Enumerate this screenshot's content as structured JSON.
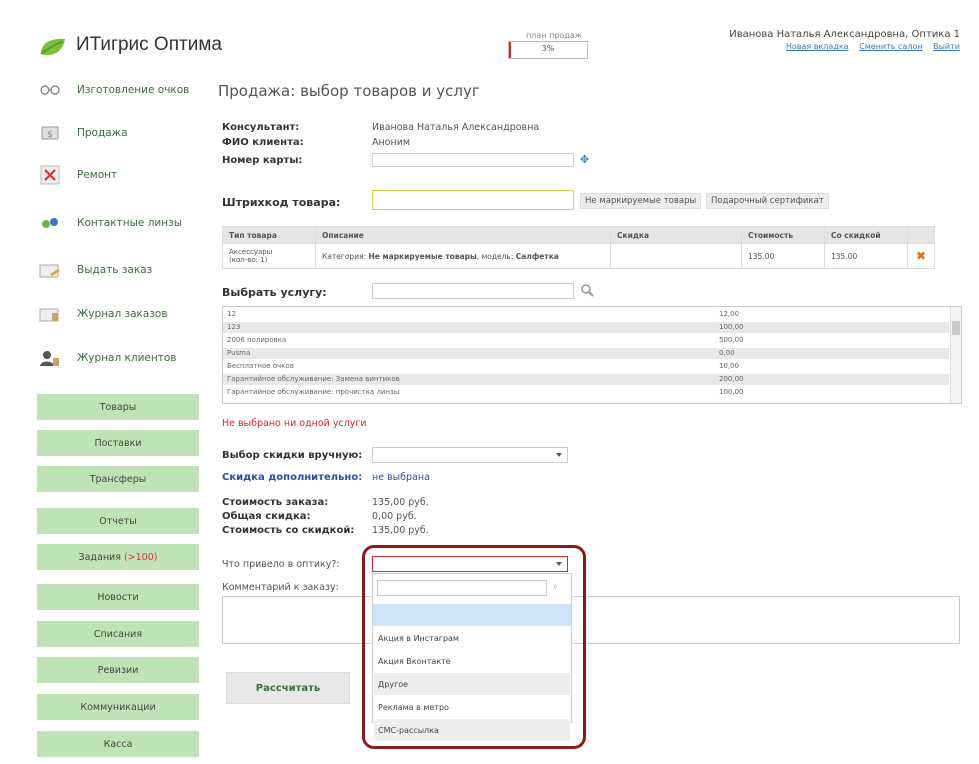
{
  "header": {
    "app_title": "ИТигрис Оптима",
    "plan_label": "план продаж",
    "plan_value": "3%",
    "plan_fraction": 0.03,
    "user": "Иванова Наталья Александровна, Оптика 1",
    "links": [
      "Новая вкладка",
      "Сменить салон",
      "Выйти"
    ]
  },
  "sidebar": {
    "icon_items": [
      {
        "label": "Изготовление очков",
        "icon": "glasses-icon"
      },
      {
        "label": "Продажа",
        "icon": "sale-icon"
      },
      {
        "label": "Ремонт",
        "icon": "repair-icon"
      },
      {
        "label": "Контактные линзы",
        "icon": "contact-lens-icon"
      },
      {
        "label": "Выдать заказ",
        "icon": "issue-order-icon"
      },
      {
        "label": "Журнал заказов",
        "icon": "orders-journal-icon"
      },
      {
        "label": "Журнал клиентов",
        "icon": "clients-journal-icon"
      }
    ],
    "menu_items": [
      "Товары",
      "Поставки",
      "Трансферы",
      "Отчеты",
      "Задания",
      "Новости",
      "Списания",
      "Ревизии",
      "Коммуникации",
      "Касса"
    ],
    "tasks_badge": "(>100)"
  },
  "main": {
    "title": "Продажа: выбор товаров и услуг",
    "consultant_label": "Консультант:",
    "consultant_value": "Иванова Наталья Александровна",
    "client_label": "ФИО клиента:",
    "client_value": "Аноним",
    "card_label": "Номер карты:",
    "card_value": "",
    "barcode_label": "Штрихкод товара:",
    "barcode_value": "",
    "btn_unmarked": "Не маркируемые товары",
    "btn_gift": "Подарочный сертификат",
    "table": {
      "headers": [
        "Тип товара",
        "Описание",
        "Скидка",
        "Стоимость",
        "Со скидкой"
      ],
      "row": {
        "type": "Аксессуары",
        "qty": "(кол-во: 1)",
        "category_label": "Категория:",
        "category": "Не маркируемые товары",
        "model_label": "модель:",
        "model": "Салфетка",
        "discount": "",
        "price": "135.00",
        "price_discount": "135.00"
      }
    },
    "service_label": "Выбрать услугу:",
    "services": [
      {
        "name": "12",
        "price": "12,00"
      },
      {
        "name": "123",
        "price": "100,00"
      },
      {
        "name": "2006 полировка",
        "price": "500,00"
      },
      {
        "name": "Pusma",
        "price": "0,00"
      },
      {
        "name": "Бесплатное очков",
        "price": "10,00"
      },
      {
        "name": "Гарантийное обслуживание: Замена винтиков",
        "price": "200,00"
      },
      {
        "name": "Гарантийное обслуживание: прочистка линзы",
        "price": "100,00"
      }
    ],
    "no_service": "Не выбрано ни одной услуги",
    "discount_label": "Выбор скидки вручную:",
    "discount_value": "",
    "extra_discount_label": "Скидка дополнительно:",
    "extra_discount_value": "не выбрана",
    "order_cost_label": "Стоимость заказа:",
    "order_cost_value": "135,00 руб.",
    "total_discount_label": "Общая скидка:",
    "total_discount_value": "0,00 руб.",
    "cost_with_discount_label": "Стоимость со скидкой:",
    "cost_with_discount_value": "135,00 руб.",
    "reason_label": "Что привело в оптику?:",
    "reason_value": "",
    "comment_label": "Комментарий к заказу:",
    "comment_value": "",
    "calc_button": "Рассчитать",
    "dropdown_search": "",
    "dropdown_options": [
      "Акция в Инстаграм",
      "Акция Вконтакте",
      "Другое",
      "Реклама в метро",
      "СМС-рассылка"
    ]
  }
}
